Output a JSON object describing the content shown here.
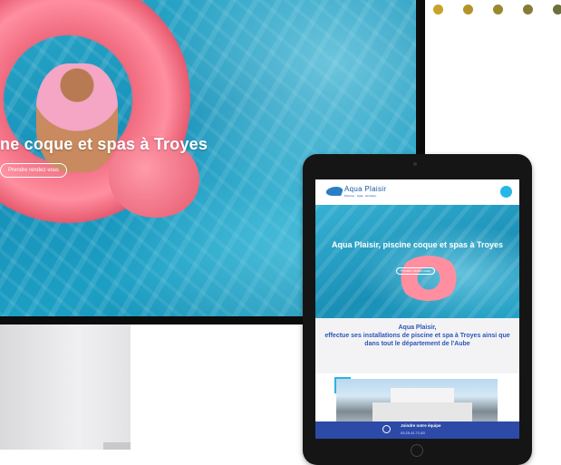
{
  "dots": [
    "#c9a227",
    "#b39428",
    "#9a8a2c",
    "#857d36",
    "#6e6e3c"
  ],
  "desktop": {
    "hero_title": "ne coque et spas à Troyes",
    "hero_button": "Prendre rendez-vous"
  },
  "tablet": {
    "logo": "Aqua Plaisir",
    "logo_tagline": "Piscines · Spas · Entretien",
    "hero_title": "Aqua Plaisir, piscine coque et spas à Troyes",
    "hero_button": "Prendre rendez-vous",
    "intro_title": "Aqua Plaisir,\neffectue ses installations de piscine et spa à Troyes ainsi que dans tout le département de l'Aube",
    "footer_label": "Joindre notre équipe",
    "footer_phone": "03.25.41.71.83"
  }
}
